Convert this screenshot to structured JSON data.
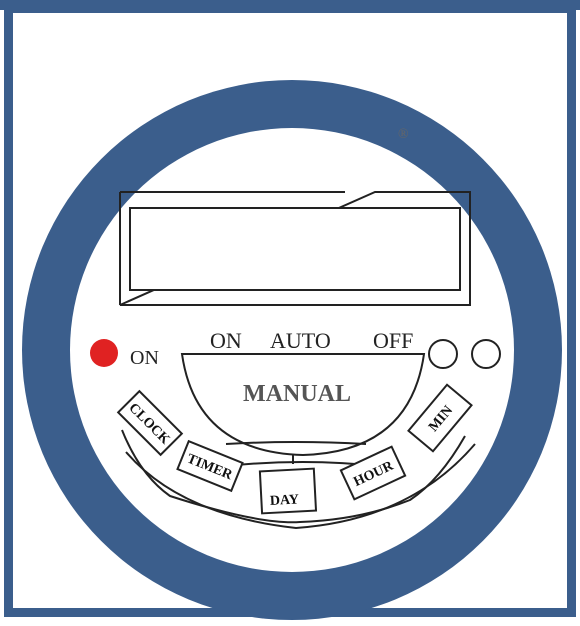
{
  "colors": {
    "frame": "#3b5e8c",
    "face": "#ffffff",
    "line": "#222222",
    "led": "#e02222",
    "manual_text": "#555555"
  },
  "mark": "®",
  "indicator": {
    "label": "ON",
    "led_color": "#e02222"
  },
  "mode": {
    "on": "ON",
    "auto": "AUTO",
    "off": "OFF"
  },
  "manual_label": "MANUAL",
  "buttons": {
    "clock": "CLOCK",
    "timer": "TIMER",
    "day": "DAY",
    "hour": "HOUR",
    "min": "MIN"
  },
  "icons": [
    "registered-mark",
    "led-indicator",
    "round-button"
  ]
}
